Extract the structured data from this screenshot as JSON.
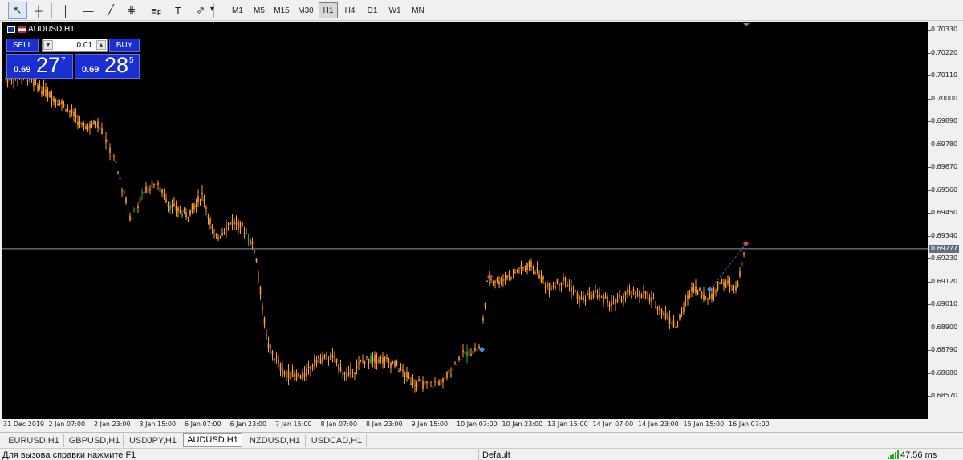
{
  "toolbar": {
    "tools": [
      {
        "name": "cursor-icon",
        "glyph": "↖",
        "active": true
      },
      {
        "name": "crosshair-icon",
        "glyph": "┼",
        "active": false
      },
      {
        "name": "vertical-line-icon",
        "glyph": "│",
        "active": false
      },
      {
        "name": "horizontal-line-icon",
        "glyph": "—",
        "active": false
      },
      {
        "name": "trendline-icon",
        "glyph": "╱",
        "active": false
      },
      {
        "name": "equidistant-channel-icon",
        "glyph": "⋕",
        "active": false
      },
      {
        "name": "fibonacci-icon",
        "glyph": "≡",
        "active": false
      },
      {
        "name": "text-label-icon",
        "glyph": "T",
        "active": false
      },
      {
        "name": "arrow-shapes-icon",
        "glyph": "⇗",
        "active": false
      }
    ],
    "fibo_badge": "F",
    "timeframes": [
      "M1",
      "M5",
      "M15",
      "M30",
      "H1",
      "H4",
      "D1",
      "W1",
      "MN"
    ],
    "active_timeframe": "H1"
  },
  "chart": {
    "title": "AUDUSD,H1",
    "background": "#000000",
    "candle_color": "#ff9d2a",
    "bull_tick_color": "#2ea84a",
    "grid_line_color": "#9a9a9a",
    "current_price": "0.69277"
  },
  "trade_panel": {
    "sell_label": "SELL",
    "buy_label": "BUY",
    "lot": "0.01",
    "sell_price": {
      "prefix": "0.69",
      "big": "27",
      "sup": "7"
    },
    "buy_price": {
      "prefix": "0.69",
      "big": "28",
      "sup": "5"
    }
  },
  "price_axis": [
    "0.70330",
    "0.70220",
    "0.70110",
    "0.70000",
    "0.69890",
    "0.69780",
    "0.69670",
    "0.69560",
    "0.69450",
    "0.69340",
    "0.69230",
    "0.69120",
    "0.69010",
    "0.68900",
    "0.68790",
    "0.68680",
    "0.68570"
  ],
  "time_axis": [
    "31 Dec 2019",
    "2 Jan 07:00",
    "2 Jan 23:00",
    "3 Jan 15:00",
    "6 Jan 07:00",
    "6 Jan 23:00",
    "7 Jan 15:00",
    "8 Jan 07:00",
    "8 Jan 23:00",
    "9 Jan 15:00",
    "10 Jan 07:00",
    "10 Jan 23:00",
    "13 Jan 15:00",
    "14 Jan 07:00",
    "14 Jan 23:00",
    "15 Jan 15:00",
    "16 Jan 07:00"
  ],
  "tabs": [
    "EURUSD,H1",
    "GBPUSD,H1",
    "USDJPY,H1",
    "AUDUSD,H1",
    "NZDUSD,H1",
    "USDCAD,H1"
  ],
  "active_tab": "AUDUSD,H1",
  "status": {
    "help": "Для вызова справки нажмите F1",
    "profile": "Default",
    "ping": "47.56 ms"
  }
}
